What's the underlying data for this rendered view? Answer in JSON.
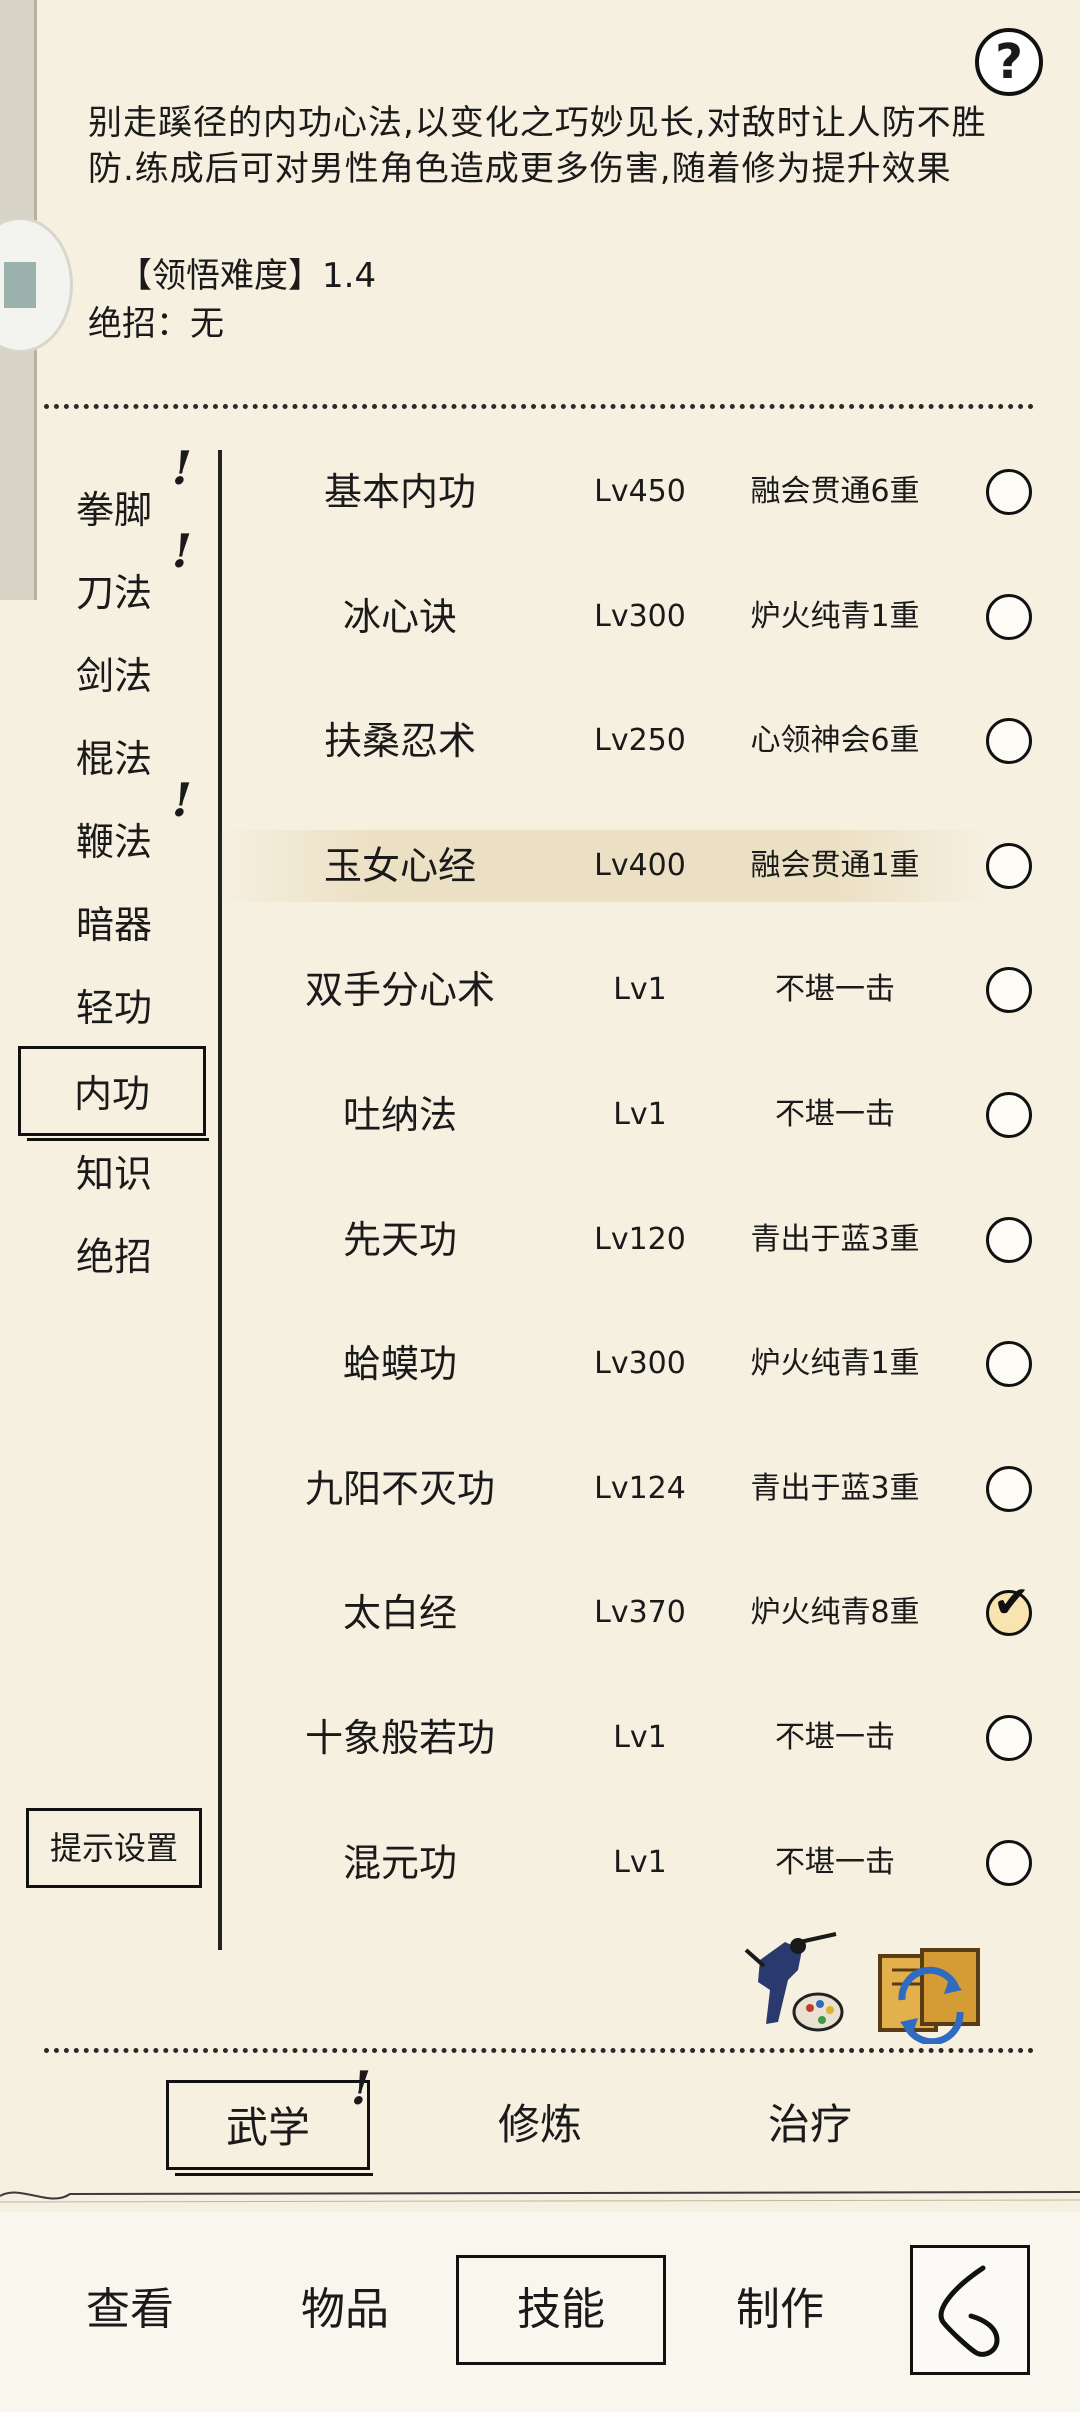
{
  "description": {
    "text": "别走蹊径的内功心法,以变化之巧妙见长,对敌时让人防不胜防.练成后可对男性角色造成更多伤害,随着修为提升效果",
    "difficulty": "【领悟难度】1.4",
    "ultimate": "绝招：无"
  },
  "help_label": "?",
  "categories": [
    {
      "label": "拳脚",
      "alert": "!"
    },
    {
      "label": "刀法",
      "alert": "!"
    },
    {
      "label": "剑法",
      "alert": ""
    },
    {
      "label": "棍法",
      "alert": ""
    },
    {
      "label": "鞭法",
      "alert": "!"
    },
    {
      "label": "暗器",
      "alert": ""
    },
    {
      "label": "轻功",
      "alert": ""
    },
    {
      "label": "内功",
      "alert": "",
      "selected": true
    },
    {
      "label": "知识",
      "alert": ""
    },
    {
      "label": "绝招",
      "alert": ""
    }
  ],
  "hint_settings": "提示设置",
  "skills": [
    {
      "name": "基本内功",
      "level": "Lv450",
      "rank": "融会贯通6重",
      "checked": false
    },
    {
      "name": "冰心诀",
      "level": "Lv300",
      "rank": "炉火纯青1重",
      "checked": false
    },
    {
      "name": "扶桑忍术",
      "level": "Lv250",
      "rank": "心领神会6重",
      "checked": false
    },
    {
      "name": "玉女心经",
      "level": "Lv400",
      "rank": "融会贯通1重",
      "checked": false,
      "highlight": true
    },
    {
      "name": "双手分心术",
      "level": "Lv1",
      "rank": "不堪一击",
      "checked": false
    },
    {
      "name": "吐纳法",
      "level": "Lv1",
      "rank": "不堪一击",
      "checked": false
    },
    {
      "name": "先天功",
      "level": "Lv120",
      "rank": "青出于蓝3重",
      "checked": false
    },
    {
      "name": "蛤蟆功",
      "level": "Lv300",
      "rank": "炉火纯青1重",
      "checked": false
    },
    {
      "name": "九阳不灭功",
      "level": "Lv124",
      "rank": "青出于蓝3重",
      "checked": false
    },
    {
      "name": "太白经",
      "level": "Lv370",
      "rank": "炉火纯青8重",
      "checked": true
    },
    {
      "name": "十象般若功",
      "level": "Lv1",
      "rank": "不堪一击",
      "checked": false
    },
    {
      "name": "混元功",
      "level": "Lv1",
      "rank": "不堪一击",
      "checked": false
    }
  ],
  "subtabs": {
    "wuxue": "武学",
    "wuxue_alert": "!",
    "xiulian": "修炼",
    "zhiliao": "治疗"
  },
  "bottom_nav": {
    "view": "查看",
    "items": "物品",
    "skills": "技能",
    "craft": "制作"
  },
  "icons": {
    "martial": "martial-artist-palette-icon",
    "swap": "scroll-swap-icon",
    "back": "back-arrow-icon",
    "help": "question-icon"
  }
}
